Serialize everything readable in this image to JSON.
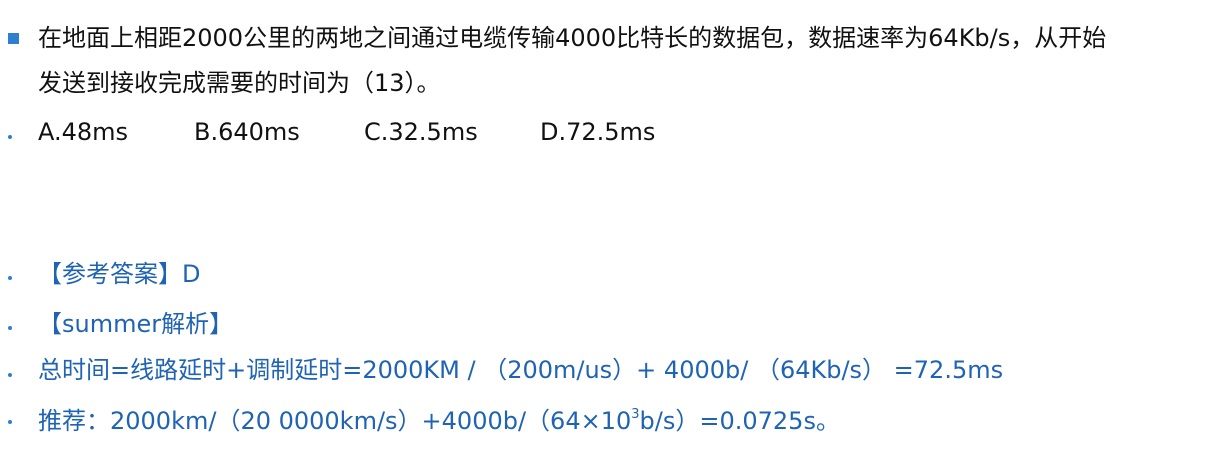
{
  "question": {
    "line1": "在地面上相距2000公里的两地之间通过电缆传输4000比特长的数据包，数据速率为64Kb/s，从开始",
    "line2": "发送到接收完成需要的时间为（13）。"
  },
  "options": [
    "A.48ms",
    "B.640ms",
    "C.32.5ms",
    "D.72.5ms"
  ],
  "answer": "【参考答案】D",
  "analysis_title": "【summer解析】",
  "formula1": "总时间=线路延时+调制延时=2000KM / （200m/us）+ 4000b/ （64Kb/s） =72.5ms",
  "formula2": {
    "prefix": "推荐：2000km/（20 0000km/s）+4000b/（64×10",
    "exponent": "3",
    "suffix": "b/s）=0.0725s。"
  },
  "colors": {
    "bullet": "#2f7fd0",
    "answer_text": "#1f63b5",
    "question_text": "#111111"
  }
}
